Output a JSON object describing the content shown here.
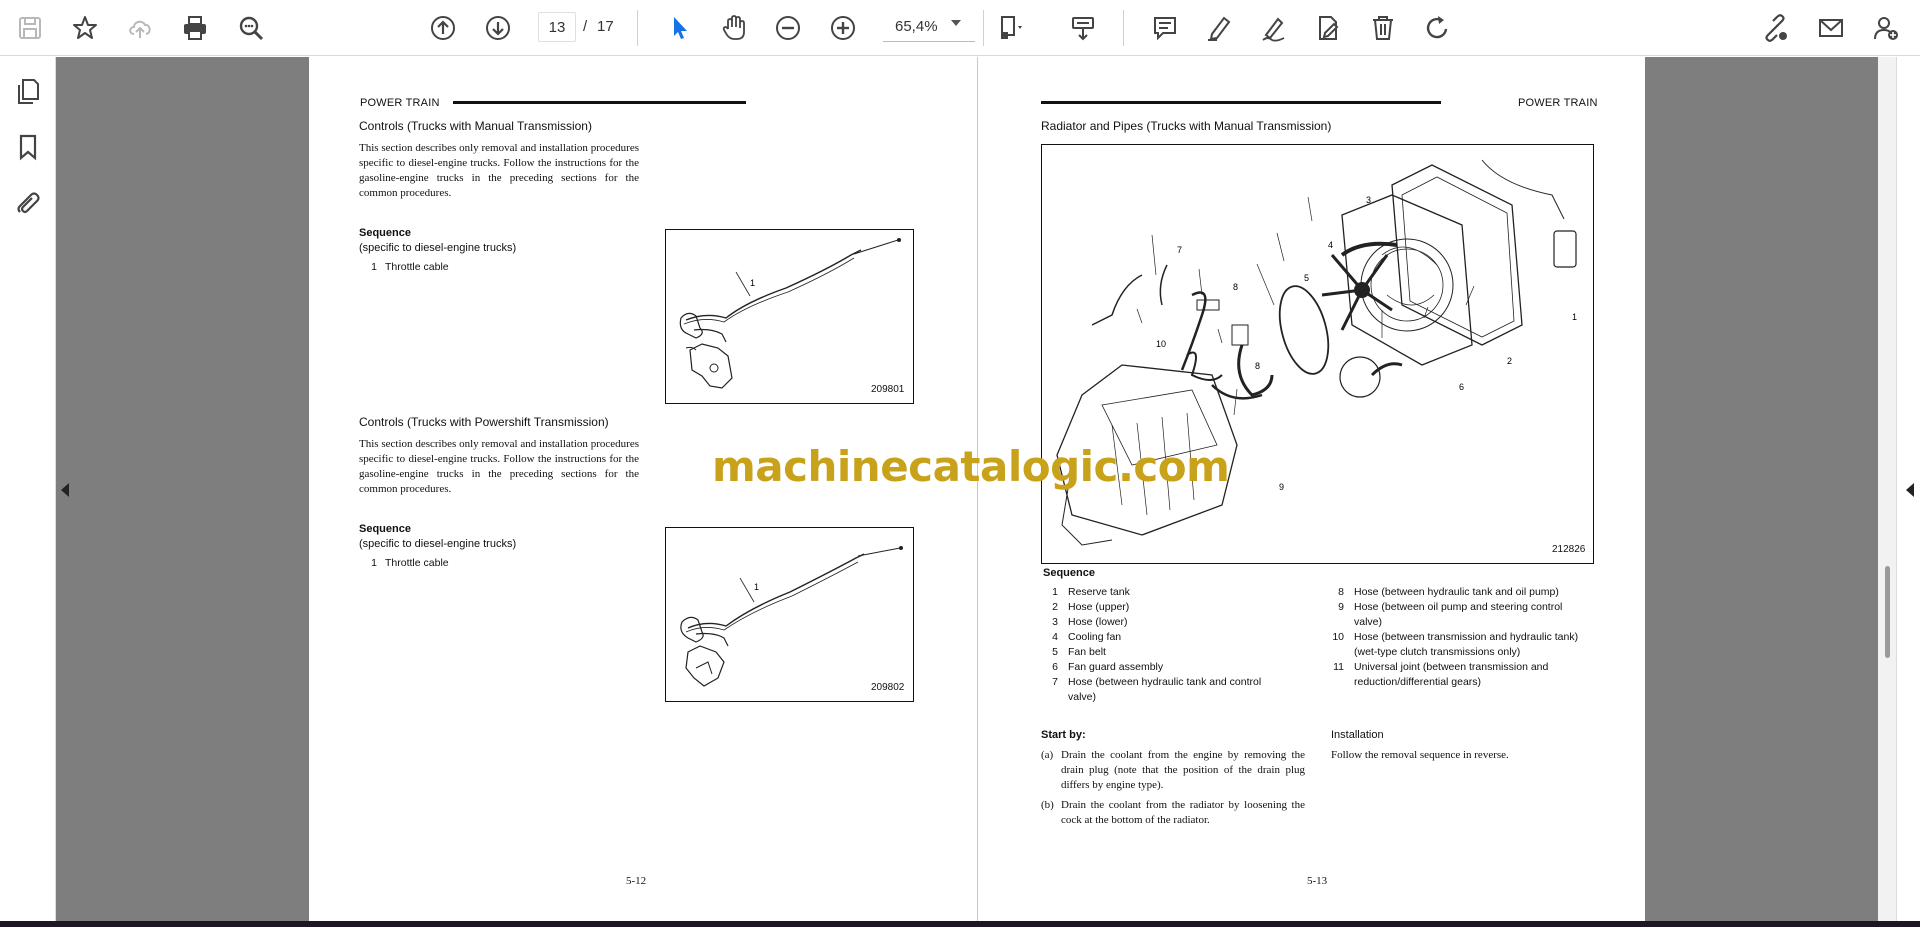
{
  "toolbar": {
    "page_current": "13",
    "page_separator": "/",
    "page_total": "17",
    "zoom": "65,4%"
  },
  "left_page": {
    "header": "POWER TRAIN",
    "section1_title": "Controls (Trucks with Manual Transmission)",
    "section1_para": "This section describes only removal and installation procedures specific to diesel-engine trucks. Follow the instructions for the gasoline-engine trucks in the preceding sections for the common procedures.",
    "section1_seq_title": "Sequence",
    "section1_seq_sub": "(specific to diesel-engine trucks)",
    "section1_items": [
      {
        "n": "1",
        "t": "Throttle cable"
      }
    ],
    "figure1_id": "209801",
    "figure1_callout": "1",
    "section2_title": "Controls (Trucks with Powershift Transmission)",
    "section2_para": "This section describes only removal and installation procedures specific to diesel-engine trucks. Follow the instructions for the gasoline-engine trucks in the preceding sections for the common procedures.",
    "section2_seq_title": "Sequence",
    "section2_seq_sub": "(specific to diesel-engine trucks)",
    "section2_items": [
      {
        "n": "1",
        "t": "Throttle cable"
      }
    ],
    "figure2_id": "209802",
    "figure2_callout": "1",
    "page_number": "5-12"
  },
  "right_page": {
    "header": "POWER TRAIN",
    "title": "Radiator and Pipes (Trucks with Manual Transmission)",
    "figure_id": "212826",
    "figure_callouts": [
      "1",
      "2",
      "3",
      "4",
      "5",
      "6",
      "7",
      "8",
      "8",
      "9",
      "10"
    ],
    "seq_title": "Sequence",
    "items_left": [
      {
        "n": "1",
        "t": "Reserve tank"
      },
      {
        "n": "2",
        "t": "Hose (upper)"
      },
      {
        "n": "3",
        "t": "Hose (lower)"
      },
      {
        "n": "4",
        "t": "Cooling fan"
      },
      {
        "n": "5",
        "t": "Fan belt"
      },
      {
        "n": "6",
        "t": "Fan guard assembly"
      },
      {
        "n": "7",
        "t": "Hose (between hydraulic tank and control valve)"
      }
    ],
    "items_right": [
      {
        "n": "8",
        "t": "Hose (between hydraulic tank and oil pump)"
      },
      {
        "n": "9",
        "t": "Hose (between oil pump and steering control valve)"
      },
      {
        "n": "10",
        "t": "Hose (between transmission and hydraulic tank) (wet-type clutch transmissions only)"
      },
      {
        "n": "11",
        "t": "Universal joint (between transmission and reduction/differential gears)"
      }
    ],
    "start_by_title": "Start by:",
    "steps": [
      {
        "s": "(a)",
        "t": "Drain the coolant from the engine by removing the drain plug (note that the position of the drain plug differs by engine type)."
      },
      {
        "s": "(b)",
        "t": "Drain the coolant from the radiator by loosening the cock at the bottom of the radiator."
      }
    ],
    "installation_title": "Installation",
    "installation_text": "Follow the removal sequence in reverse.",
    "page_number": "5-13"
  },
  "watermark": "machinecatalogic.com",
  "icons": {
    "toolbar": [
      "save-icon",
      "bookmark-star-icon",
      "cloud-upload-icon",
      "print-icon",
      "zoom-search-icon",
      "previous-page-icon",
      "next-page-icon",
      "select-cursor-icon",
      "hand-tool-icon",
      "zoom-out-icon",
      "zoom-in-icon",
      "page-fit-icon",
      "scroll-mode-icon",
      "comment-icon",
      "highlight-pen-icon",
      "draw-pen-icon",
      "sign-icon",
      "delete-icon",
      "rotate-icon",
      "share-link-icon",
      "email-icon",
      "add-user-icon"
    ],
    "left_panel": [
      "pages-icon",
      "bookmark-icon",
      "attachment-icon"
    ]
  }
}
